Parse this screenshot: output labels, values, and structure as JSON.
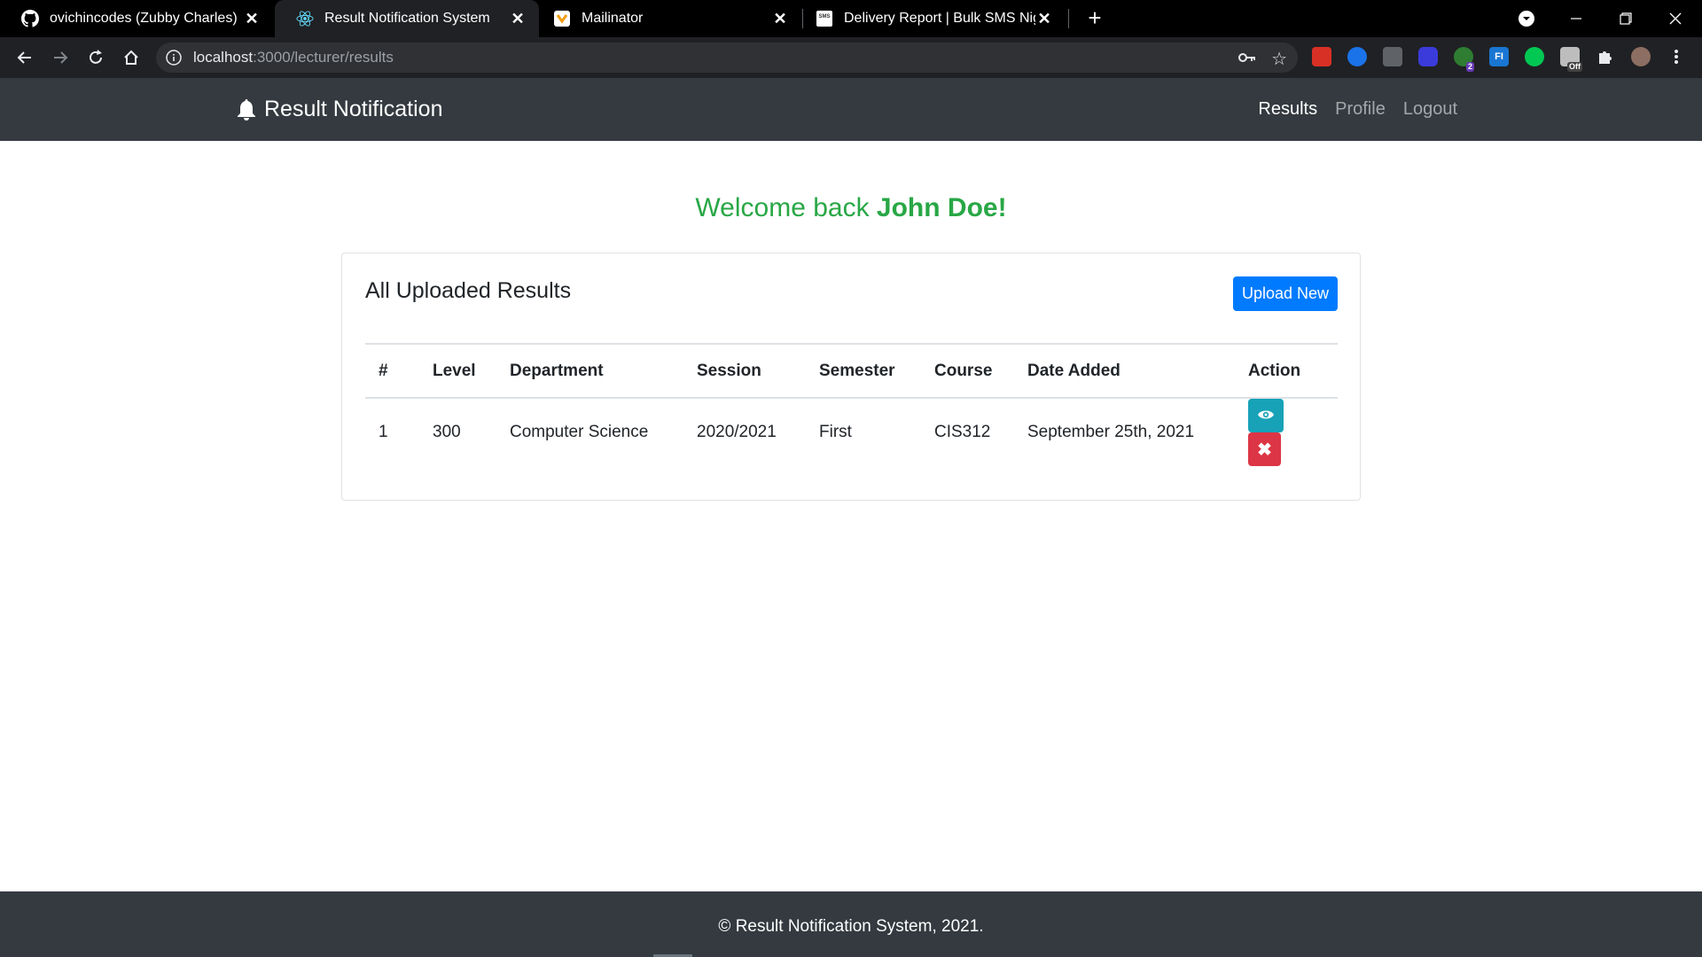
{
  "browser": {
    "tabs": [
      {
        "title": "ovichincodes (Zubby Charles)",
        "icon": "github-icon",
        "close": "✕"
      },
      {
        "title": "Result Notification System",
        "icon": "react-icon",
        "close": "✕"
      },
      {
        "title": "Mailinator",
        "icon": "mailinator-icon",
        "close": "✕"
      },
      {
        "title": "Delivery Report | Bulk SMS Nigeri",
        "icon": "sms-icon",
        "close": "✕"
      }
    ],
    "new_tab": "+",
    "url_host": "localhost",
    "url_path": ":3000/lecturer/results",
    "extensions": [
      {
        "name": "red-extension-icon",
        "label": "",
        "color": "#d93025"
      },
      {
        "name": "globe-extension-icon",
        "label": "",
        "color": "#1a73e8"
      },
      {
        "name": "grey-extension-icon",
        "label": "",
        "color": "#5f6368"
      },
      {
        "name": "blue-extension-icon",
        "label": "",
        "color": "#3b3bdb"
      },
      {
        "name": "green-extension-icon",
        "label": "",
        "color": "#2e7d32"
      },
      {
        "name": "fi-extension-icon",
        "label": "FI",
        "color": "#1976d2"
      },
      {
        "name": "teal-extension-icon",
        "label": "",
        "color": "#00c853"
      },
      {
        "name": "toggle-extension-icon",
        "label": "",
        "color": "#bdbdbd"
      }
    ],
    "badge_count": "2",
    "badge_off": "Off"
  },
  "nav": {
    "brand": "Result Notification",
    "links": [
      "Results",
      "Profile",
      "Logout"
    ]
  },
  "welcome": {
    "prefix": "Welcome back ",
    "name": "John Doe!"
  },
  "results": {
    "title": "All Uploaded Results",
    "upload_button": "Upload New",
    "columns": [
      "#",
      "Level",
      "Department",
      "Session",
      "Semester",
      "Course",
      "Date Added",
      "Action"
    ],
    "rows": [
      {
        "num": "1",
        "level": "300",
        "department": "Computer Science",
        "session": "2020/2021",
        "semester": "First",
        "course": "CIS312",
        "date_added": "September 25th, 2021"
      }
    ],
    "delete_glyph": "✖"
  },
  "footer": {
    "text": "© Result Notification System, 2021."
  },
  "colors": {
    "navbar": "#343a40",
    "success": "#28a745",
    "primary": "#007bff",
    "info": "#17a2b8",
    "danger": "#dc3545"
  }
}
